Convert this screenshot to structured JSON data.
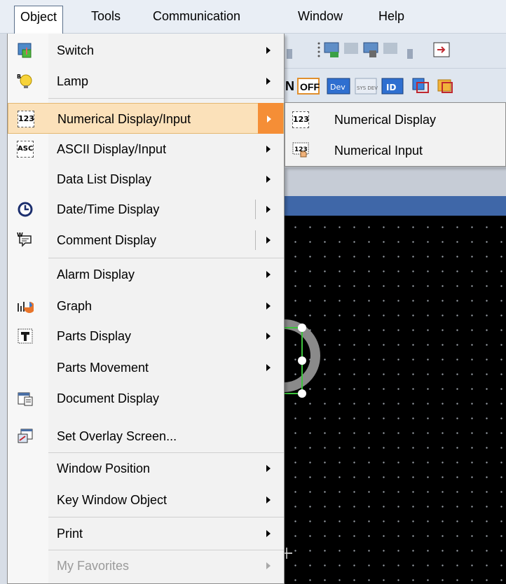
{
  "menubar": {
    "items": [
      "Object",
      "Tools",
      "Communication",
      "Window",
      "Help"
    ]
  },
  "toolbar": {
    "buttons": [
      "N",
      "OFF",
      "Dev",
      "SYS DEV",
      "ID"
    ]
  },
  "object_menu": {
    "items": [
      {
        "label": "Switch",
        "icon": "switch-icon",
        "has_submenu": true
      },
      {
        "label": "Lamp",
        "icon": "lamp-icon",
        "has_submenu": true
      },
      {
        "label": "Numerical Display/Input",
        "icon": "numerical-display-icon",
        "has_submenu": true,
        "highlighted": true
      },
      {
        "label": "ASCII Display/Input",
        "icon": "ascii-display-icon",
        "has_submenu": true
      },
      {
        "label": "Data List Display",
        "icon": "",
        "has_submenu": true
      },
      {
        "label": "Date/Time Display",
        "icon": "clock-icon",
        "has_submenu": true
      },
      {
        "label": "Comment Display",
        "icon": "comment-icon",
        "has_submenu": true
      },
      {
        "label": "Alarm Display",
        "icon": "",
        "has_submenu": true
      },
      {
        "label": "Graph",
        "icon": "graph-icon",
        "has_submenu": true
      },
      {
        "label": "Parts Display",
        "icon": "parts-display-icon",
        "has_submenu": true
      },
      {
        "label": "Parts Movement",
        "icon": "",
        "has_submenu": true
      },
      {
        "label": "Document Display",
        "icon": "document-display-icon",
        "has_submenu": false
      },
      {
        "label": "Set Overlay Screen...",
        "icon": "overlay-screen-icon",
        "has_submenu": false
      },
      {
        "label": "Window Position",
        "icon": "",
        "has_submenu": true
      },
      {
        "label": "Key Window Object",
        "icon": "",
        "has_submenu": true
      },
      {
        "label": "Print",
        "icon": "",
        "has_submenu": true
      },
      {
        "label": "My Favorites",
        "icon": "",
        "has_submenu": true,
        "disabled": true
      }
    ]
  },
  "submenu": {
    "items": [
      {
        "label": "Numerical Display",
        "icon": "numerical-display-icon"
      },
      {
        "label": "Numerical Input",
        "icon": "numerical-input-icon"
      }
    ]
  },
  "icons": {
    "numerical_display_glyph": "123",
    "ascii_glyph": "ASC"
  },
  "colors": {
    "highlight_bg": "#fbe1ba",
    "highlight_arrow": "#f58e36",
    "editor_bg": "#000000"
  }
}
